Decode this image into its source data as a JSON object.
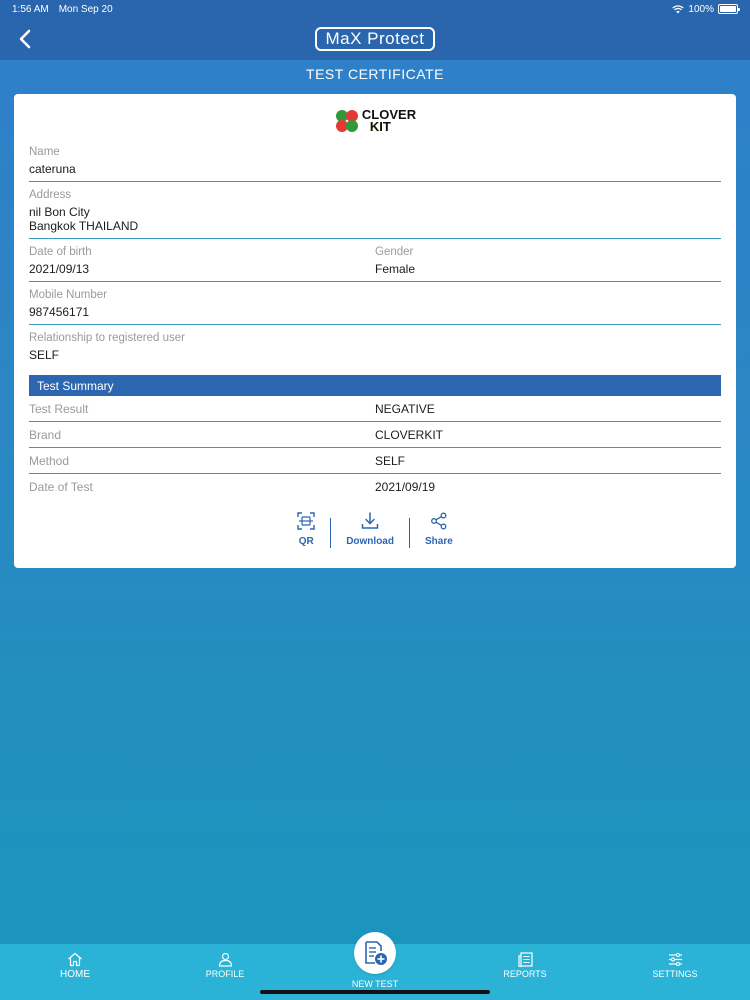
{
  "status_bar": {
    "time": "1:56 AM",
    "date": "Mon Sep 20",
    "battery": "100%"
  },
  "nav": {
    "logo_text": "MaX Protect"
  },
  "page_title": "TEST CERTIFICATE",
  "brand": {
    "logo_line1": "CLOVER",
    "logo_line2": "KIT"
  },
  "fields": {
    "name_label": "Name",
    "name_value": "cateruna",
    "address_label": "Address",
    "address_line1": "nil Bon City",
    "address_line2": "Bangkok THAILAND",
    "dob_label": "Date of birth",
    "dob_value": "2021/09/13",
    "gender_label": "Gender",
    "gender_value": "Female",
    "mobile_label": "Mobile Number",
    "mobile_value": "987456171",
    "relationship_label": "Relationship to registered user",
    "relationship_value": "SELF"
  },
  "summary": {
    "header": "Test Summary",
    "rows": [
      {
        "label": "Test Result",
        "value": "NEGATIVE"
      },
      {
        "label": "Brand",
        "value": "CLOVERKIT"
      },
      {
        "label": "Method",
        "value": "SELF"
      },
      {
        "label": "Date of Test",
        "value": "2021/09/19"
      }
    ]
  },
  "actions": {
    "qr": "QR",
    "download": "Download",
    "share": "Share"
  },
  "tabs": {
    "home": "HOME",
    "profile": "PROFILE",
    "new_test": "NEW TEST",
    "reports": "REPORTS",
    "settings": "SETTINGS"
  },
  "colors": {
    "primary": "#2c66b0",
    "tab_bar": "#2ab3d6",
    "divider": "#3a9ac0"
  }
}
